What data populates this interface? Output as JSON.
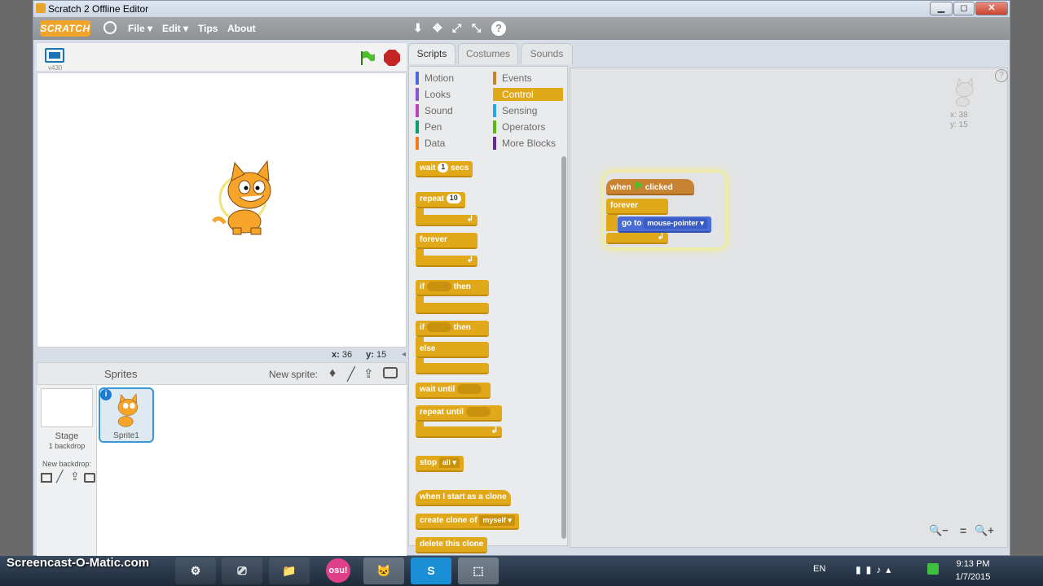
{
  "window": {
    "title": "Scratch 2 Offline Editor",
    "minimize": "▁",
    "maximize": "◻",
    "close": "✕"
  },
  "menubar": {
    "logo": "SCRATCH",
    "items": [
      "File ▾",
      "Edit ▾",
      "Tips",
      "About"
    ],
    "tools": [
      "⬇",
      "✥",
      "⤢",
      "⤡",
      "?"
    ]
  },
  "stage": {
    "version": "v430",
    "x_label": "x:",
    "x_value": "36",
    "y_label": "y:",
    "y_value": "15"
  },
  "sprites": {
    "header": "Sprites",
    "new_sprite_label": "New sprite:",
    "stage_label": "Stage",
    "backdrop_count": "1 backdrop",
    "new_backdrop_label": "New backdrop:",
    "sprite1_name": "Sprite1"
  },
  "tabs": [
    "Scripts",
    "Costumes",
    "Sounds"
  ],
  "categories": {
    "left": [
      {
        "label": "Motion",
        "color": "#4a6cd4"
      },
      {
        "label": "Looks",
        "color": "#8a55d7"
      },
      {
        "label": "Sound",
        "color": "#bb42c3"
      },
      {
        "label": "Pen",
        "color": "#0e9a6c"
      },
      {
        "label": "Data",
        "color": "#ee7d16"
      }
    ],
    "right": [
      {
        "label": "Events",
        "color": "#c88330"
      },
      {
        "label": "Control",
        "color": "#e1a91a"
      },
      {
        "label": "Sensing",
        "color": "#2ca5e2"
      },
      {
        "label": "Operators",
        "color": "#5cb712"
      },
      {
        "label": "More Blocks",
        "color": "#632d99"
      }
    ]
  },
  "palette_blocks": {
    "wait": "wait",
    "wait_val": "1",
    "wait_unit": "secs",
    "repeat": "repeat",
    "repeat_val": "10",
    "forever": "forever",
    "if1": "if",
    "then1": "then",
    "if2": "if",
    "then2": "then",
    "else": "else",
    "wait_until": "wait until",
    "repeat_until": "repeat until",
    "stop": "stop",
    "stop_val": "all ▾",
    "clone_start": "when I start as a clone",
    "create_clone": "create clone of",
    "create_clone_val": "myself ▾",
    "delete_clone": "delete this clone"
  },
  "script": {
    "hat_when": "when",
    "hat_clicked": "clicked",
    "forever": "forever",
    "goto": "go to",
    "goto_val": "mouse-pointer ▾"
  },
  "sprite_info": {
    "x": "x: 38",
    "y": "y: 15"
  },
  "zoom": {
    "out": "🔍−",
    "reset": "=",
    "in": "🔍+"
  },
  "taskbar": {
    "watermark": "Screencast-O-Matic.com",
    "lang": "EN",
    "time": "9:13 PM",
    "date": "1/7/2015",
    "apps": [
      "⚙",
      "⎚",
      "📁",
      "osu!",
      "🐱",
      "S",
      "⬚"
    ]
  }
}
